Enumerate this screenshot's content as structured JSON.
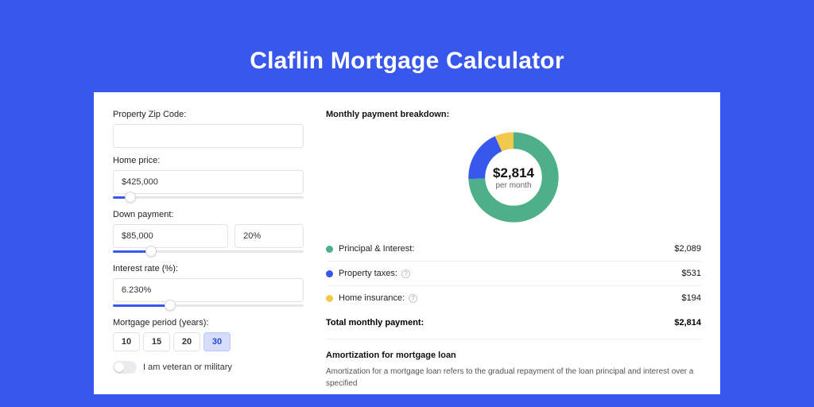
{
  "title": "Claflin Mortgage Calculator",
  "form": {
    "zip_label": "Property Zip Code:",
    "zip_value": "",
    "home_price_label": "Home price:",
    "home_price_value": "$425,000",
    "home_price_fill_pct": 9,
    "down_payment_label": "Down payment:",
    "down_payment_amount": "$85,000",
    "down_payment_percent": "20%",
    "down_payment_fill_pct": 20,
    "interest_label": "Interest rate (%):",
    "interest_value": "6.230%",
    "interest_fill_pct": 30,
    "period_label": "Mortgage period (years):",
    "periods": [
      "10",
      "15",
      "20",
      "30"
    ],
    "period_selected": "30",
    "veteran_label": "I am veteran or military"
  },
  "breakdown": {
    "title": "Monthly payment breakdown:",
    "center_value": "$2,814",
    "center_sub": "per month",
    "items": [
      {
        "label": "Principal & Interest:",
        "value": "$2,089",
        "color": "#4eb08a",
        "info": false
      },
      {
        "label": "Property taxes:",
        "value": "$531",
        "color": "#3757ed",
        "info": true
      },
      {
        "label": "Home insurance:",
        "value": "$194",
        "color": "#f2c94c",
        "info": true
      }
    ],
    "total_label": "Total monthly payment:",
    "total_value": "$2,814"
  },
  "chart_data": {
    "type": "pie",
    "title": "Monthly payment breakdown",
    "series": [
      {
        "name": "Principal & Interest",
        "value": 2089,
        "color": "#4eb08a"
      },
      {
        "name": "Property taxes",
        "value": 531,
        "color": "#3757ed"
      },
      {
        "name": "Home insurance",
        "value": 194,
        "color": "#f2c94c"
      }
    ],
    "total": 2814
  },
  "amortization": {
    "title": "Amortization for mortgage loan",
    "text": "Amortization for a mortgage loan refers to the gradual repayment of the loan principal and interest over a specified"
  }
}
